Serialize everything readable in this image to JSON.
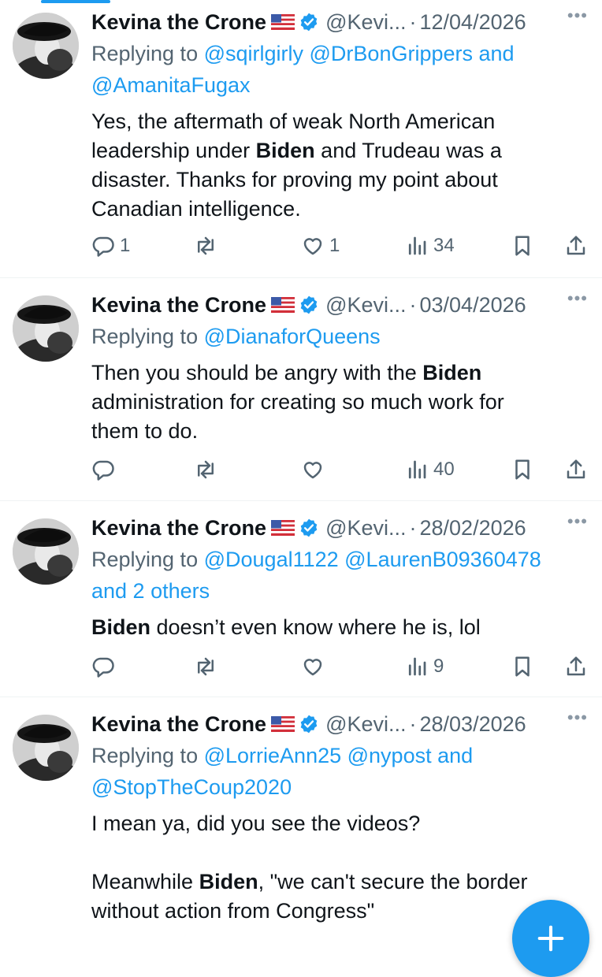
{
  "accent_color": "#1d9bf0",
  "tweets": [
    {
      "name": "Kevina the Crone",
      "flag": "us-flag-icon",
      "handle": "@Kevi...",
      "date": "12/04/2026",
      "reply_prefix": "Replying to",
      "reply_line1": "@sqirlgirly @DrBonGrippers and",
      "reply_line2": "@AmanitaFugax",
      "body": [
        {
          "t": "Yes, the aftermath of weak North American"
        },
        {
          "t": "leadership under "
        },
        {
          "b": "Biden"
        },
        {
          "t": " and Trudeau was a"
        },
        {
          "t": "disaster. Thanks for proving my point about"
        },
        {
          "t": "Canadian intelligence."
        }
      ],
      "replies": "1",
      "retweets": "",
      "likes": "1",
      "views": "34"
    },
    {
      "name": "Kevina the Crone",
      "flag": "us-flag-icon",
      "handle": "@Kevi...",
      "date": "03/04/2026",
      "reply_prefix": "Replying to",
      "reply_line1": "@DianaforQueens",
      "reply_line2": "",
      "body_text_1": "Then you should be angry with the ",
      "body_bold_1": "Biden",
      "body_text_2": "administration for creating so much work for",
      "body_text_3": "them to do.",
      "replies": "",
      "retweets": "",
      "likes": "",
      "views": "40"
    },
    {
      "name": "Kevina the Crone",
      "flag": "us-flag-icon",
      "handle": "@Kevi...",
      "date": "28/02/2026",
      "reply_prefix": "Replying to",
      "reply_line1": "@Dougal1122 @LaurenB09360478",
      "reply_line2": "and 2 others",
      "body_bold_1": "Biden",
      "body_text_1": " doesn’t even know where he is, lol",
      "replies": "",
      "retweets": "",
      "likes": "",
      "views": "9"
    },
    {
      "name": "Kevina the Crone",
      "flag": "us-flag-icon",
      "handle": "@Kevi...",
      "date": "28/03/2026",
      "reply_prefix": "Replying to",
      "reply_line1": "@LorrieAnn25 @nypost and",
      "reply_line2": "@StopTheCoup2020",
      "body_text_1": "I mean ya, did you see the videos?",
      "body_text_2": "Meanwhile ",
      "body_bold_1": "Biden",
      "body_text_3": ", \"we can't secure the border",
      "body_text_4": "without action from Congress\""
    }
  ],
  "fab_icon": "plus-icon"
}
